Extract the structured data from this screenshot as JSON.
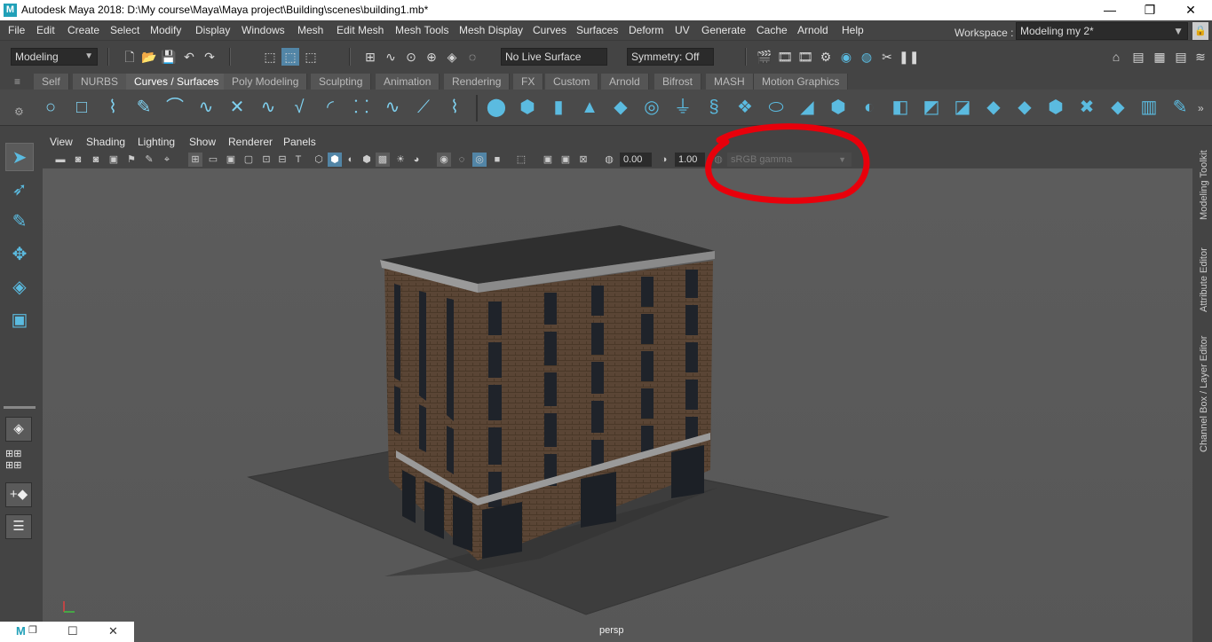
{
  "window": {
    "title": "Autodesk Maya 2018: D:\\My course\\Maya\\Maya project\\Building\\scenes\\building1.mb*",
    "logo": "M",
    "minimize": "—",
    "restore": "❐",
    "close": "✕"
  },
  "menubar": {
    "items": [
      "File",
      "Edit",
      "Create",
      "Select",
      "Modify",
      "Display",
      "Windows",
      "Mesh",
      "Edit Mesh",
      "Mesh Tools",
      "Mesh Display",
      "Curves",
      "Surfaces",
      "Deform",
      "UV",
      "Generate",
      "Cache",
      "Arnold",
      "Help"
    ],
    "workspace_label": "Workspace :",
    "workspace_value": "Modeling my 2*"
  },
  "statusline": {
    "menuset": "Modeling",
    "live_surface": "No Live Surface",
    "symmetry": "Symmetry: Off"
  },
  "shelf": {
    "tabs": [
      "Self",
      "NURBS",
      "Curves / Surfaces",
      "Poly Modeling",
      "Sculpting",
      "Animation",
      "Rendering",
      "FX",
      "Custom",
      "Arnold",
      "Bifrost",
      "MASH",
      "Motion Graphics"
    ],
    "active_tab": "Curves / Surfaces"
  },
  "panel": {
    "menus": [
      "View",
      "Shading",
      "Lighting",
      "Show",
      "Renderer",
      "Panels"
    ],
    "exposure": "0.00",
    "gamma": "1.00",
    "color_space": "sRGB gamma",
    "camera_label": "persp"
  },
  "rightbar": {
    "tabs": [
      "Modeling Toolkit",
      "Attribute Editor",
      "Channel Box / Layer Editor"
    ]
  },
  "colors": {
    "accent": "#5bbbe0",
    "annotation": "#e8000b",
    "viewport_bg": "#5a5a5a"
  }
}
